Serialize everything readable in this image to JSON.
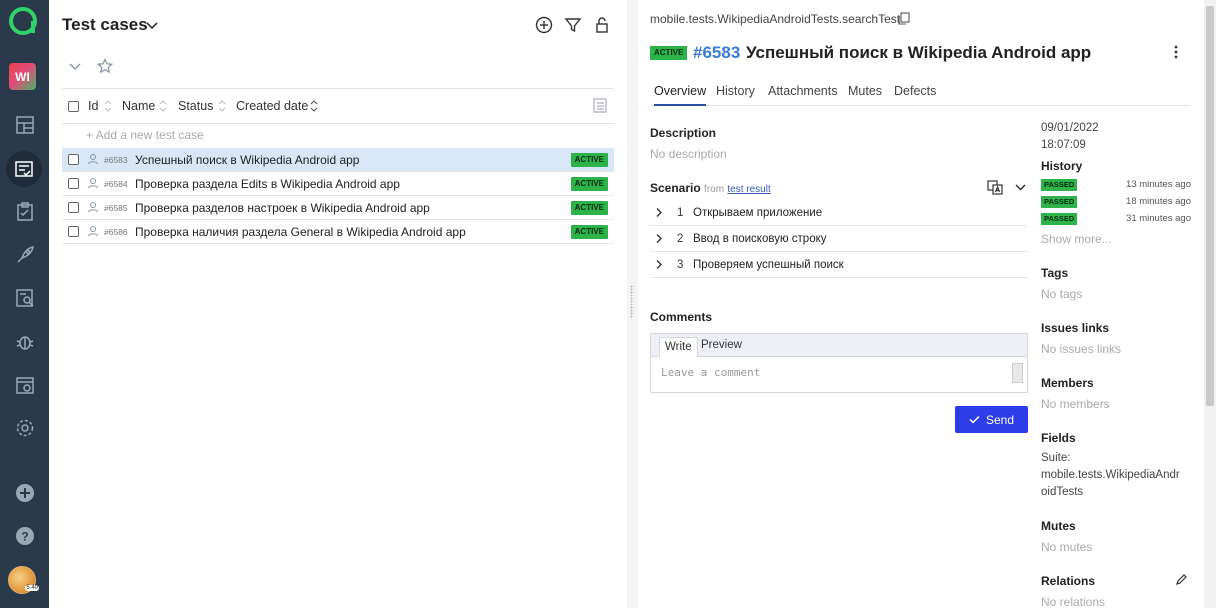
{
  "rail": {
    "project_initials": "WI",
    "avatar_badge": "5.40",
    "items": [
      "dashboards-icon",
      "test-cases-icon",
      "launches-icon",
      "deploy-icon",
      "analytics-icon",
      "defects-icon",
      "jobs-icon",
      "settings-icon",
      "add-icon",
      "help-icon"
    ]
  },
  "list": {
    "title": "Test cases",
    "columns": {
      "id": "Id",
      "name": "Name",
      "status": "Status",
      "created": "Created date"
    },
    "add_placeholder": "+  Add a new test case",
    "rows": [
      {
        "id": "#6583",
        "name": "Успешный поиск в Wikipedia Android app",
        "status": "ACTIVE",
        "selected": true
      },
      {
        "id": "#6584",
        "name": "Проверка раздела Edits в Wikipedia Android app",
        "status": "ACTIVE",
        "selected": false
      },
      {
        "id": "#6585",
        "name": "Проверка разделов настроек в Wikipedia Android app",
        "status": "ACTIVE",
        "selected": false
      },
      {
        "id": "#6586",
        "name": "Проверка наличия раздела General в Wikipedia Android app",
        "status": "ACTIVE",
        "selected": false
      }
    ]
  },
  "detail": {
    "path": "mobile.tests.WikipediaAndroidTests.searchTest",
    "status": "ACTIVE",
    "id": "#6583",
    "title": "Успешный поиск в Wikipedia Android app",
    "tabs": [
      "Overview",
      "History",
      "Attachments",
      "Mutes",
      "Defects"
    ],
    "description_label": "Description",
    "description_value": "No description",
    "scenario_label": "Scenario",
    "scenario_from": "from",
    "scenario_link": "test result",
    "steps": [
      {
        "num": "1",
        "text": "Открываем приложение"
      },
      {
        "num": "2",
        "text": "Ввод в поисковую строку"
      },
      {
        "num": "3",
        "text": "Проверяем успешный поиск"
      }
    ],
    "comments_label": "Comments",
    "comment_tabs": {
      "write": "Write",
      "preview": "Preview"
    },
    "comment_placeholder": "Leave a comment",
    "send_label": "Send",
    "side": {
      "date": "09/01/2022",
      "time": "18:07:09",
      "history_label": "History",
      "history": [
        {
          "status": "PASSED",
          "ago": "13 minutes ago"
        },
        {
          "status": "PASSED",
          "ago": "18 minutes ago"
        },
        {
          "status": "PASSED",
          "ago": "31 minutes ago"
        }
      ],
      "show_more": "Show more...",
      "tags_label": "Tags",
      "tags_value": "No tags",
      "issues_label": "Issues links",
      "issues_value": "No issues links",
      "members_label": "Members",
      "members_value": "No members",
      "fields_label": "Fields",
      "fields_line1": "Suite:",
      "fields_line2": "mobile.tests.WikipediaAndr",
      "fields_line3": "oidTests",
      "mutes_label": "Mutes",
      "mutes_value": "No mutes",
      "relations_label": "Relations",
      "relations_value": "No relations"
    }
  },
  "colors": {
    "rail": "#2b3a4a",
    "accent": "#2d3de8",
    "active_badge": "#2db34a",
    "link": "#3a7bd5",
    "selected_row": "#d9e6f6"
  }
}
